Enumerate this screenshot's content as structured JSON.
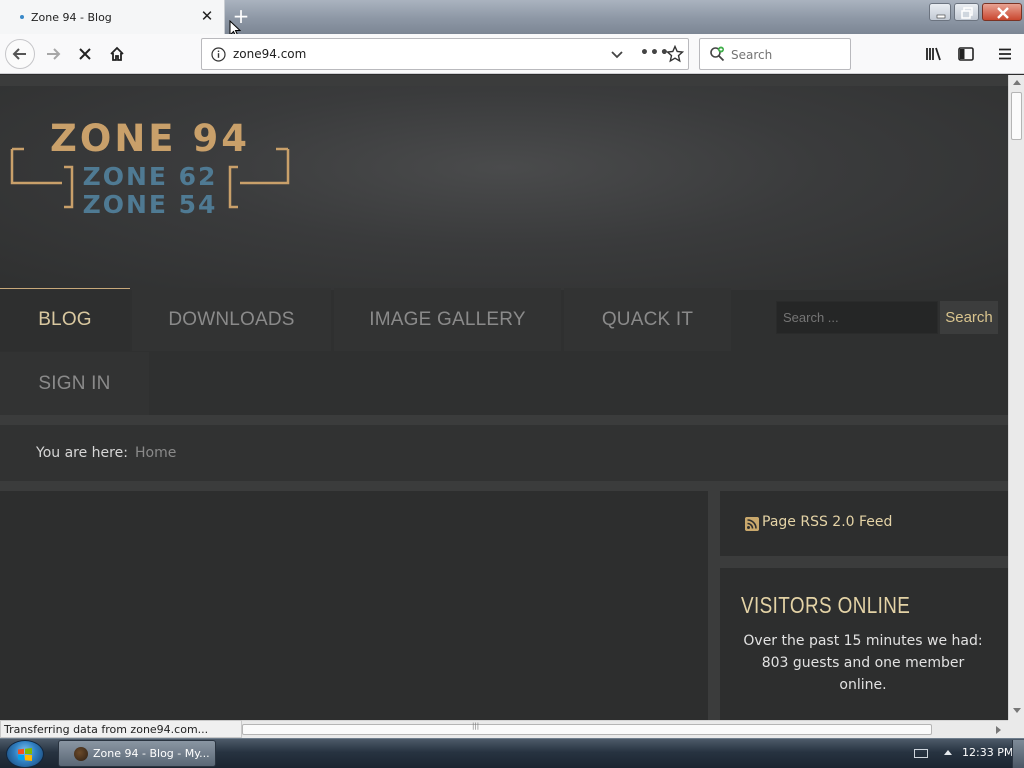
{
  "browser": {
    "tab_title": "Zone 94 - Blog",
    "url": "zone94.com",
    "search_placeholder": "Search",
    "status_text": "Transferring data from zone94.com..."
  },
  "site": {
    "logo_main": "ZONE 94",
    "logo_sub1": "ZONE 62",
    "logo_sub2": "ZONE 54",
    "menu": [
      {
        "label": "BLOG",
        "active": true
      },
      {
        "label": "DOWNLOADS",
        "active": false
      },
      {
        "label": "IMAGE GALLERY",
        "active": false
      },
      {
        "label": "QUACK IT",
        "active": false
      },
      {
        "label": "SIGN IN",
        "active": false
      }
    ],
    "search": {
      "placeholder": "Search ...",
      "button_label": "Search"
    },
    "breadcrumb": {
      "label": "You are here:",
      "current": "Home"
    },
    "rss_label": "Page RSS 2.0 Feed",
    "visitors": {
      "title": "VISITORS ONLINE",
      "text": "Over the past 15 minutes we had: 803 guests and one member online."
    }
  },
  "taskbar": {
    "window_label": "Zone 94 - Blog - My...",
    "clock": "12:33 PM"
  },
  "colors": {
    "accent_gold": "#c9a06a",
    "accent_blue": "#4f7a93",
    "page_bg": "#2f3030"
  }
}
